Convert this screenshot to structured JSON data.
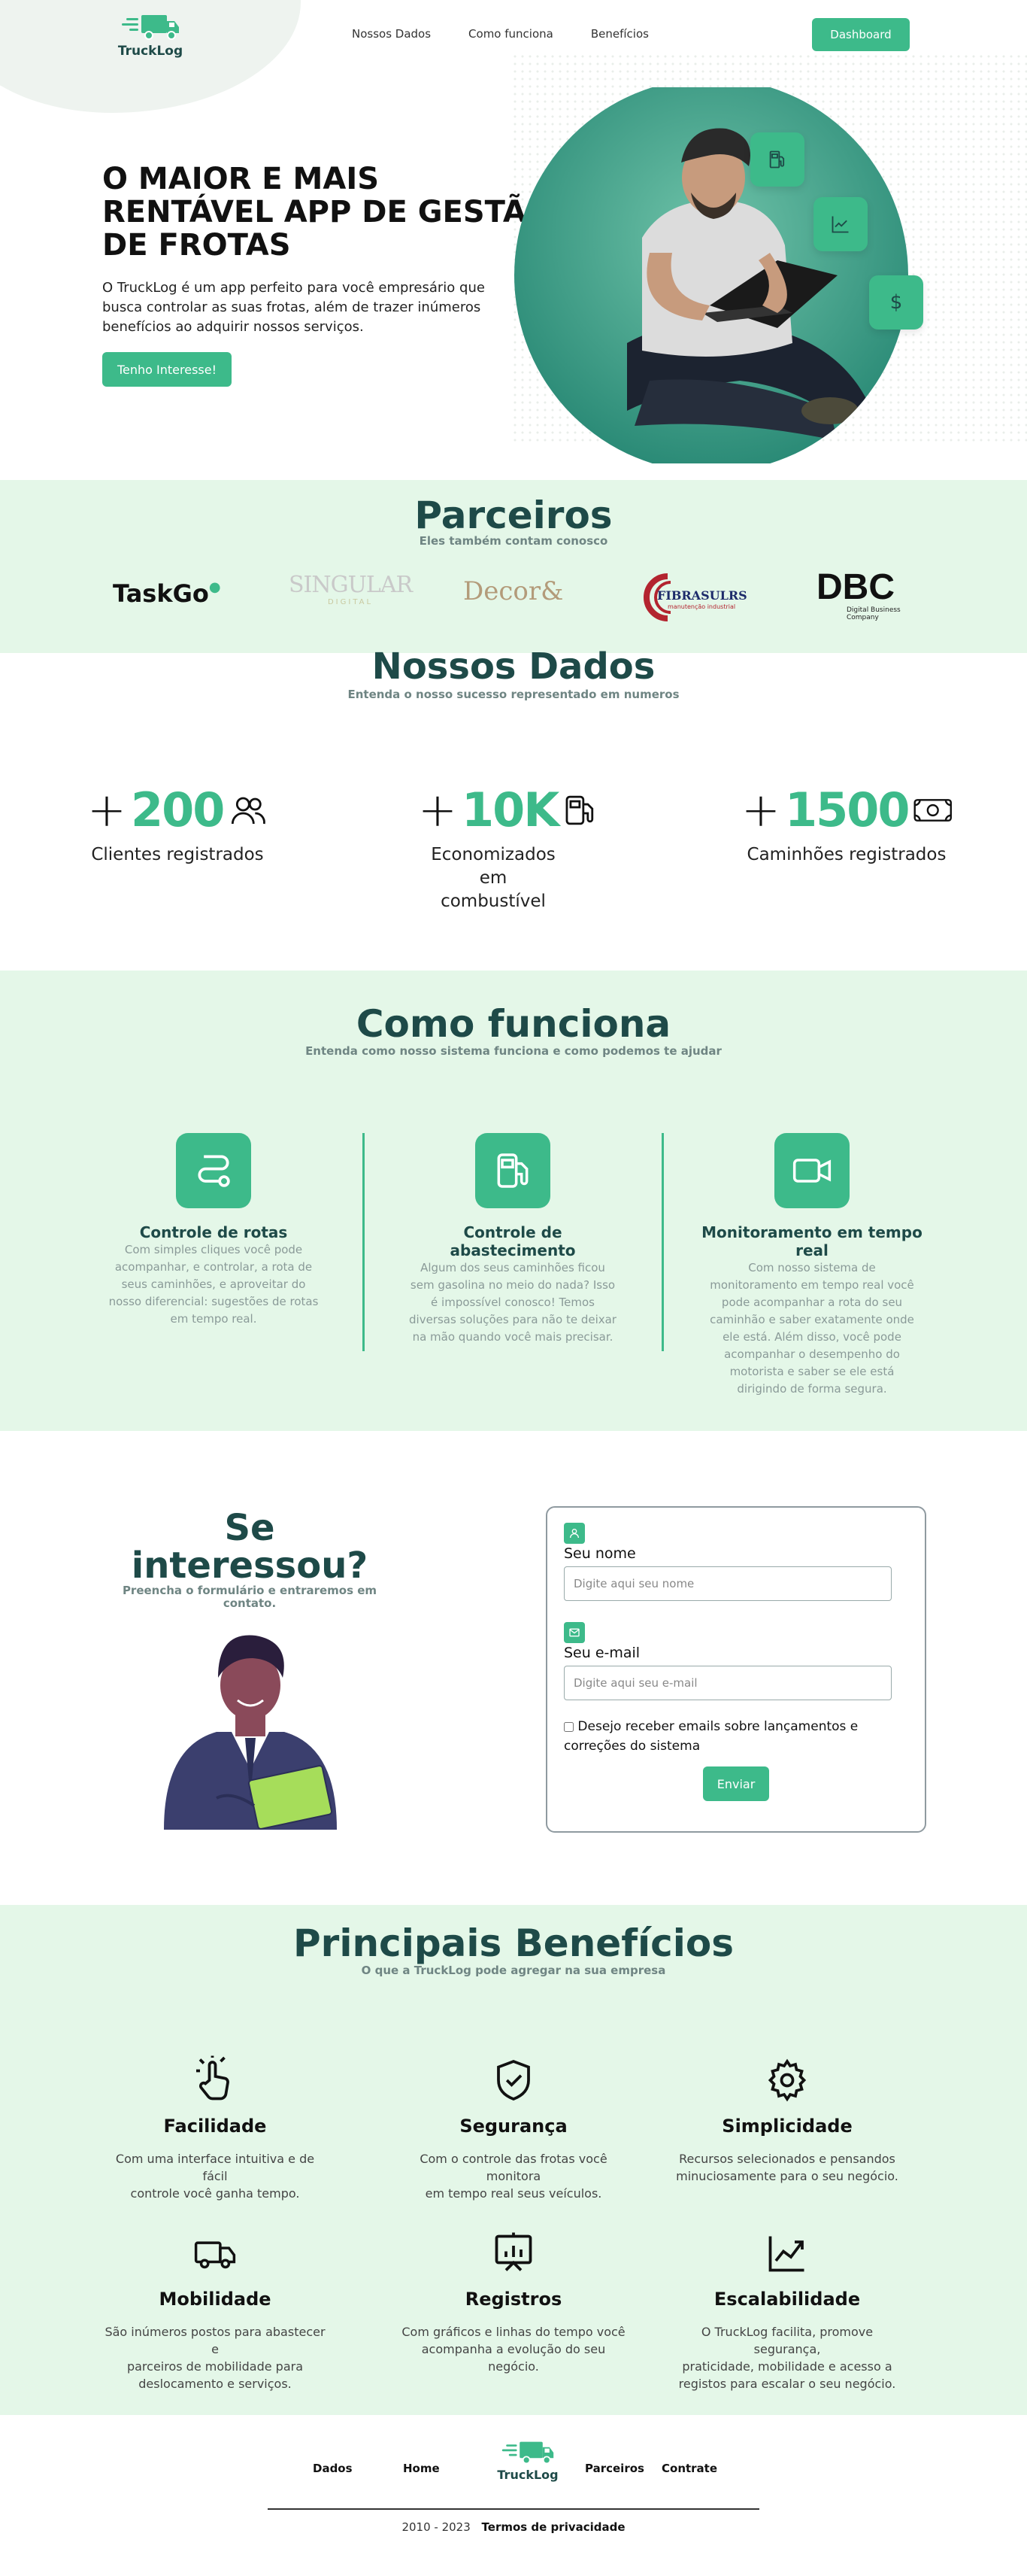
{
  "brand": {
    "name": "TruckLog"
  },
  "nav": {
    "links": [
      "Nossos Dados",
      "Como funciona",
      "Benefícios"
    ],
    "dashboard": "Dashboard"
  },
  "hero": {
    "title_lines": [
      "O MAIOR E MAIS",
      "RENTÁVEL APP DE GESTÃO",
      "DE FROTAS"
    ],
    "text_lines": [
      "O TruckLog é um app perfeito para você empresário que",
      "busca controlar as suas frotas, além de trazer inúmeros",
      "benefícios ao adquirir nossos serviços."
    ],
    "cta": "Tenho Interesse!",
    "float_icons": [
      "fuel-pump-icon",
      "chart-icon",
      "dollar-icon"
    ]
  },
  "partners": {
    "title": "Parceiros",
    "subtitle": "Eles também contam conosco",
    "logos": [
      {
        "name": "TaskGo"
      },
      {
        "name": "SINGULAR",
        "sub": "DIGITAL"
      },
      {
        "name": "Decor&"
      },
      {
        "name": "FIBRASULRS",
        "sub": "manutenção industrial"
      },
      {
        "name": "DBC",
        "sub": "Digital Business Company"
      }
    ]
  },
  "stats": {
    "title": "Nossos Dados",
    "subtitle": "Entenda o nosso sucesso representado em numeros",
    "items": [
      {
        "prefix": "+",
        "value": "200",
        "icon": "users-icon",
        "label_lines": [
          "Clientes registrados"
        ]
      },
      {
        "prefix": "+",
        "value": "10K",
        "icon": "fuel-pump-icon",
        "label_lines": [
          "Economizados em",
          "combustível"
        ]
      },
      {
        "prefix": "+",
        "value": "1500",
        "icon": "cash-icon",
        "label_lines": [
          "Caminhões registrados"
        ]
      }
    ]
  },
  "how": {
    "title": "Como funciona",
    "subtitle": "Entenda como nosso sistema funciona e como podemos te ajudar",
    "cards": [
      {
        "icon": "route-icon",
        "title_lines": [
          "Controle de rotas"
        ],
        "text_lines": [
          "Com simples cliques você pode",
          "acompanhar, e controlar, a rota de",
          "seus caminhões, e aproveitar do",
          "nosso diferencial: sugestões de rotas",
          "em tempo real."
        ]
      },
      {
        "icon": "fuel-pump-icon",
        "title_lines": [
          "Controle de",
          "abastecimento"
        ],
        "text_lines": [
          "Algum dos seus caminhões ficou",
          "sem gasolina no meio do nada? Isso",
          "é impossível conosco! Temos",
          "diversas soluções para não te deixar",
          "na mão quando você mais precisar."
        ]
      },
      {
        "icon": "video-icon",
        "title_lines": [
          "Monitoramento em tempo",
          "real"
        ],
        "text_lines": [
          "Com nosso sistema de",
          "monitoramento em tempo real você",
          "pode acompanhar a rota do seu",
          "caminhão e saber exatamente onde",
          "ele está. Além disso, você pode",
          "acompanhar o desempenho do",
          "motorista e saber se ele está",
          "dirigindo de forma segura."
        ]
      }
    ]
  },
  "contact": {
    "title_lines": [
      "Se",
      "interessou?"
    ],
    "subtitle_lines": [
      "Preencha o formulário e entraremos em",
      "contato."
    ],
    "name_label": "Seu nome",
    "name_placeholder": "Digite aqui seu nome",
    "email_label": "Seu e-mail",
    "email_placeholder": "Digite aqui seu e-mail",
    "checkbox_lines": [
      "Desejo receber emails sobre lançamentos e",
      "correções do sistema"
    ],
    "submit": "Enviar"
  },
  "benefits": {
    "title": "Principais Benefícios",
    "subtitle": "O que a TruckLog pode agregar na sua empresa",
    "items": [
      {
        "icon": "pointer-hand-icon",
        "title": "Facilidade",
        "text_lines": [
          "Com uma interface intuitiva e de fácil",
          "controle você ganha tempo."
        ]
      },
      {
        "icon": "shield-check-icon",
        "title": "Segurança",
        "text_lines": [
          "Com o controle das frotas você monitora",
          "em tempo real seus veículos."
        ]
      },
      {
        "icon": "gear-icon",
        "title": "Simplicidade",
        "text_lines": [
          "Recursos selecionados e pensandos",
          "minuciosamente para o seu negócio."
        ]
      },
      {
        "icon": "truck-icon",
        "title": "Mobilidade",
        "text_lines": [
          "São inúmeros postos para abastecer e",
          "parceiros de mobilidade para",
          "deslocamento e serviços."
        ]
      },
      {
        "icon": "presentation-chart-icon",
        "title": "Registros",
        "text_lines": [
          "Com gráficos e linhas do tempo você",
          "acompanha a evolução do seu negócio."
        ]
      },
      {
        "icon": "trend-up-icon",
        "title": "Escalabilidade",
        "text_lines": [
          "O TruckLog facilita, promove segurança,",
          "praticidade, mobilidade e acesso a",
          "registos para escalar o seu negócio."
        ]
      }
    ]
  },
  "footer": {
    "links": [
      "Dados",
      "Home",
      "Parceiros",
      "Contrate"
    ],
    "copyright": "2010 - 2023",
    "privacy": "Termos de privacidade"
  },
  "colors": {
    "accent": "#3dba8a",
    "dark": "#1e4a48",
    "mint": "#e4f7e8"
  }
}
